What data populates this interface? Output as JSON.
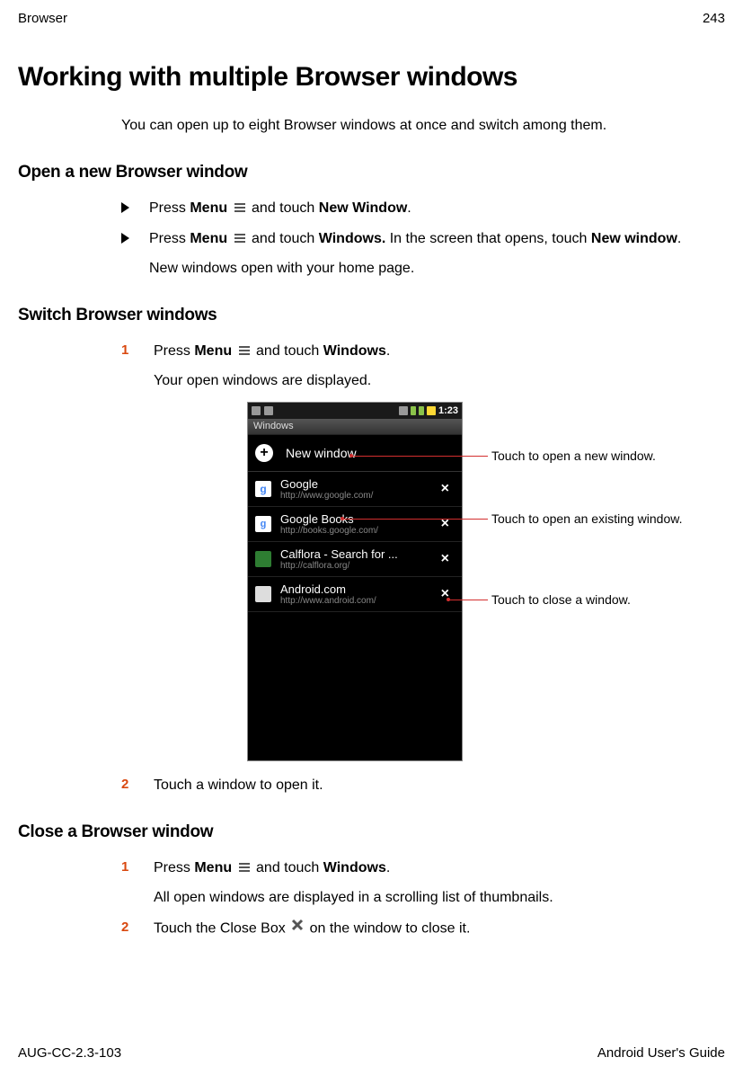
{
  "header": {
    "left": "Browser",
    "right": "243"
  },
  "title": "Working with multiple Browser windows",
  "intro": "You can open up to eight Browser windows at once and switch among them.",
  "section1": {
    "heading": "Open a new Browser window",
    "item1": {
      "pre": "Press ",
      "menu": "Menu",
      "mid": " and touch ",
      "nw": "New Window",
      "post": "."
    },
    "item2": {
      "pre": "Press ",
      "menu": "Menu",
      "mid": " and touch ",
      "win": "Windows.",
      "post1": " In the screen that opens, touch ",
      "nw": "New window",
      "post2": ".",
      "sub": "New windows open with your home page."
    }
  },
  "section2": {
    "heading": "Switch Browser windows",
    "step1": {
      "pre": "Press ",
      "menu": "Menu",
      "mid": " and touch ",
      "win": "Windows",
      "post": ".",
      "sub": "Your open windows are displayed."
    },
    "step2": "Touch a window to open it."
  },
  "section3": {
    "heading": "Close a Browser window",
    "step1": {
      "pre": "Press ",
      "menu": "Menu",
      "mid": " and touch ",
      "win": "Windows",
      "post": ".",
      "sub": "All open windows are displayed in a scrolling list of thumbnails."
    },
    "step2": {
      "pre": "Touch the Close Box ",
      "post": " on the window to close it."
    }
  },
  "phone": {
    "clock": "1:23",
    "windowsLabel": "Windows",
    "newWindow": "New window",
    "items": [
      {
        "title": "Google",
        "url": "http://www.google.com/"
      },
      {
        "title": "Google Books",
        "url": "http://books.google.com/"
      },
      {
        "title": "Calflora - Search for ...",
        "url": "http://calflora.org/"
      },
      {
        "title": "Android.com",
        "url": "http://www.android.com/"
      }
    ]
  },
  "callouts": {
    "c1": "Touch to open a new window.",
    "c2": "Touch to open an existing window.",
    "c3": "Touch to close a window."
  },
  "footer": {
    "left": "AUG-CC-2.3-103",
    "right": "Android User's Guide"
  }
}
